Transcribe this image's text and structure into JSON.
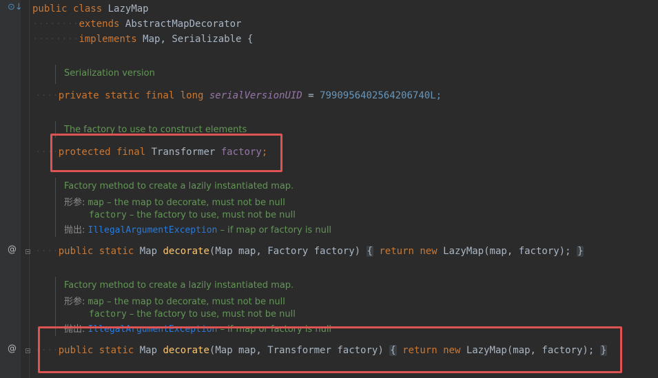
{
  "code": {
    "class_decl": {
      "kw1": "public",
      "kw2": "class",
      "name": "LazyMap"
    },
    "extends_line": {
      "kw": "extends",
      "name": "AbstractMapDecorator"
    },
    "implements_line": {
      "kw": "implements",
      "names": "Map, Serializable {"
    },
    "doc_serial": "Serialization version",
    "serial_line": {
      "kw": "private static final long",
      "name": "serialVersionUID",
      "op": "=",
      "value": "7990956402564206740L;"
    },
    "doc_factory_field": "The factory to use to construct elements",
    "factory_field": {
      "kw": "protected final",
      "type": "Transformer",
      "name": "factory",
      "semi": ";"
    },
    "doc_method1": {
      "desc": "Factory method to create a lazily instantiated map.",
      "params_tag": "形参:",
      "param1_name": "map",
      "param1_desc": " – the map to decorate, must not be null",
      "param2_name": "factory",
      "param2_desc": " – the factory to use, must not be null",
      "throws_tag": "抛出:",
      "throws_name": "IllegalArgumentException",
      "throws_desc": " – if map or factory is null"
    },
    "method1": {
      "kw": "public static",
      "ret": "Map",
      "name": "decorate",
      "params": "(Map map, Factory factory)",
      "open": "{",
      "body_kw": "return new",
      "body": "LazyMap(map, factory);",
      "close": "}"
    },
    "doc_method2": {
      "desc": "Factory method to create a lazily instantiated map.",
      "params_tag": "形参:",
      "param1_name": "map",
      "param1_desc": " – the map to decorate, must not be null",
      "param2_name": "factory",
      "param2_desc": " – the factory to use, must not be null",
      "throws_tag": "抛出:",
      "throws_name": "IllegalArgumentException",
      "throws_desc": " – if map or factory is null"
    },
    "method2": {
      "kw": "public static",
      "ret": "Map",
      "name": "decorate",
      "params": "(Map map, Transformer factory)",
      "open": "{",
      "body_kw": "return new",
      "body": "LazyMap(map, factory);",
      "close": "}"
    }
  },
  "gutter": {
    "override_icon": "override-icon",
    "at": "@",
    "bookmark": "bookmark-icon"
  },
  "colors": {
    "highlight_box": "#e05353",
    "background": "#2b2b2b",
    "keyword": "#cc7832",
    "doc": "#629755"
  }
}
